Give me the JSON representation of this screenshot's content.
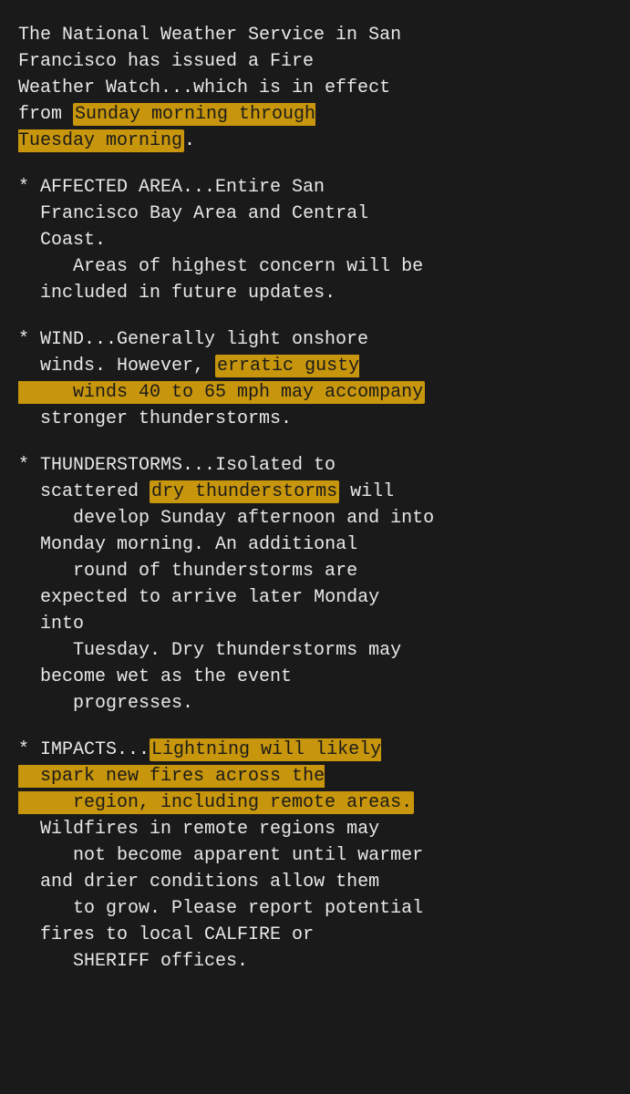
{
  "page": {
    "background": "#1a1a1a",
    "text_color": "#e8e8e8",
    "highlight_color": "#c8960c"
  },
  "content": {
    "intro": {
      "part1": "The National Weather Service in San\nFrancisco has issued a Fire\nWeather Watch...which is in effect\nfrom ",
      "highlight1": "Sunday morning through\nTuesday morning",
      "part2": "."
    },
    "affected_area": {
      "text": "* AFFECTED AREA...Entire San\n  Francisco Bay Area and Central\n  Coast.\n     Areas of highest concern will be\n  included in future updates."
    },
    "wind": {
      "part1": "* WIND...Generally light onshore\n  winds. However, ",
      "highlight1": "erratic gusty\n     winds 40 to 65 mph may accompany",
      "part2": "\n  stronger thunderstorms."
    },
    "thunderstorms": {
      "part1": "* THUNDERSTORMS...Isolated to\n  scattered ",
      "highlight1": "dry thunderstorms",
      "part2": " will\n     develop Sunday afternoon and into\n  Monday morning. An additional\n     round of thunderstorms are\n  expected to arrive later Monday\n  into\n     Tuesday. Dry thunderstorms may\n  become wet as the event\n     progresses."
    },
    "impacts": {
      "part1": "* IMPACTS...",
      "highlight1": "Lightning will likely\n  spark new fires across the\n     region, including remote areas.",
      "part2": "\n  Wildfires in remote regions may\n     not become apparent until warmer\n  and drier conditions allow them\n     to grow. Please report potential\n  fires to local CALFIRE or\n     SHERIFF offices."
    }
  }
}
